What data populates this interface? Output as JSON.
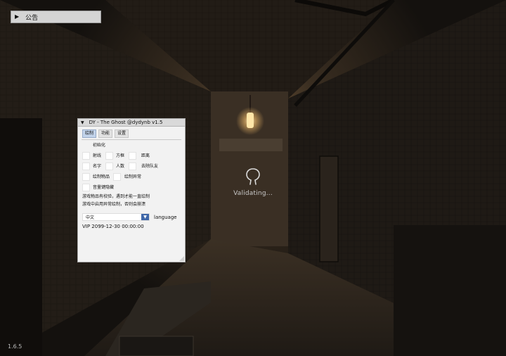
{
  "notice_bar": {
    "label": "公告"
  },
  "loading": {
    "text": "Validating..."
  },
  "version": "1.6.5",
  "menu": {
    "title": "DY - The Ghost @dydynb v1.5",
    "tabs": [
      {
        "label": "绘制",
        "active": true
      },
      {
        "label": "功能",
        "active": false
      },
      {
        "label": "设置",
        "active": false
      }
    ],
    "init_label": "初始化",
    "options": {
      "ray": "射线",
      "box": "方框",
      "distance": "距离",
      "name": "名字",
      "count": "人数",
      "remove_team": "去除队友",
      "draw_items": "绘制物品",
      "draw_anomaly": "绘制异常",
      "hide_volume": "音量键隐藏"
    },
    "notes": [
      "游戏物品有校验，遇到才能一直绘制",
      "游戏中启用异常绘制，否则会崩溃"
    ],
    "language": {
      "selected": "中文",
      "label": "language"
    },
    "vip": "VIP 2099-12-30 00:00:00"
  },
  "colors": {
    "accent": "#3f67a8",
    "tab_active": "#c2d3ea",
    "panel_bg": "#f2f2f2"
  }
}
